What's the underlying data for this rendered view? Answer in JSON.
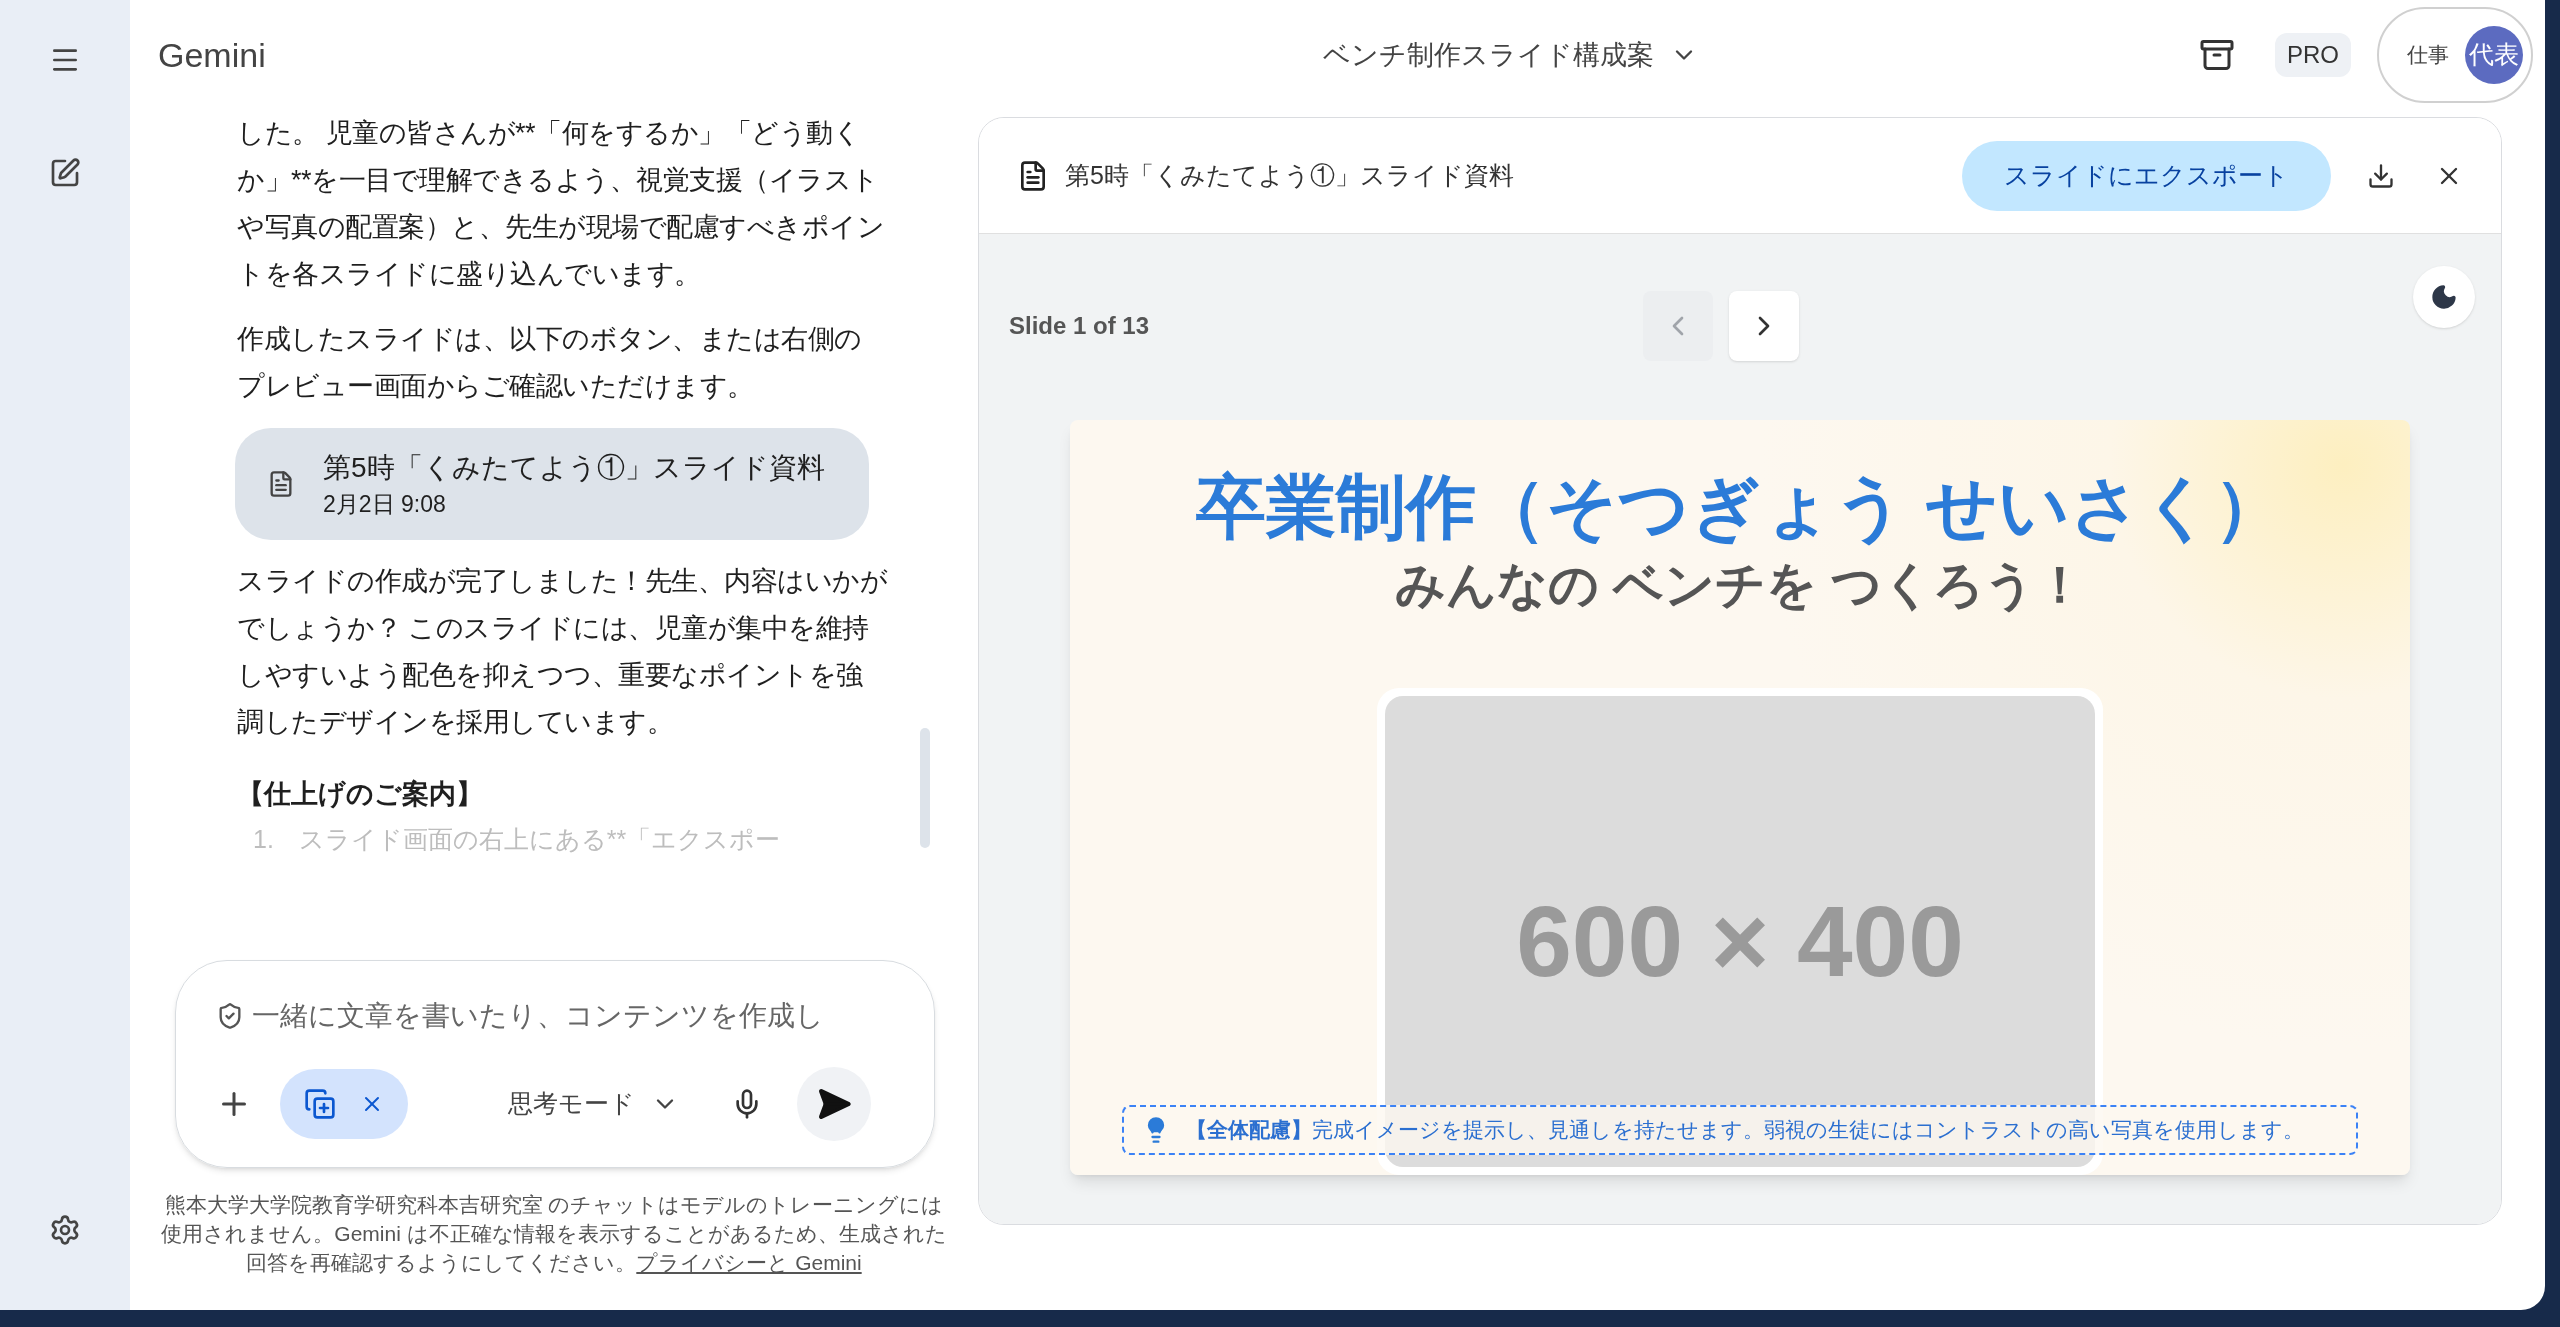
{
  "header": {
    "app_name": "Gemini",
    "conversation_title": "ベンチ制作スライド構成案",
    "plan_badge": "PRO",
    "account_label": "仕事",
    "avatar_text": "代表"
  },
  "chat": {
    "messages": [
      {
        "kind": "paragraph",
        "text": "した。 児童の皆さんが**「何をするか」「どう動くか」**を一目で理解できるよう、視覚支援（イラストや写真の配置案）と、先生が現場で配慮すべきポイントを各スライドに盛り込んでいます。"
      },
      {
        "kind": "paragraph",
        "text": "作成したスライドは、以下のボタン、または右側のプレビュー画面からご確認いただけます。"
      },
      {
        "kind": "file",
        "text": "第5時「くみたてよう①」スライド資料",
        "date": "2月2日 9:08"
      },
      {
        "kind": "paragraph",
        "text": "スライドの作成が完了しました！先生、内容はいかがでしょうか？ このスライドには、児童が集中を維持しやすいよう配色を抑えつつ、重要なポイントを強調したデザインを採用しています。"
      },
      {
        "kind": "heading",
        "text": "【仕上げのご案内】"
      },
      {
        "kind": "faded",
        "text": "1.　スライド画面の右上にある**「エクスポー"
      }
    ],
    "input": {
      "placeholder": "一緒に文章を書いたり、コンテンツを作成し",
      "tool_chip_active": true,
      "mode": "思考モード"
    },
    "footer": {
      "text": "熊本大学大学院教育学研究科本吉研究室 のチャットはモデルのトレーニングには使用されません。Gemini は不正確な情報を表示することがあるため、生成された回答を再確認するようにしてください。",
      "link": "プライバシーと Gemini"
    }
  },
  "panel": {
    "title": "第5時「くみたてよう①」スライド資料",
    "export_button": "スライドにエクスポート",
    "slide_counter": "Slide 1 of 13",
    "prev_disabled": true,
    "next_disabled": false,
    "slide": {
      "title": "卒業制作（そつぎょう せいさく）",
      "subtitle": "みんなの ベンチを つくろう！",
      "image_placeholder": "600 × 400",
      "note": "**【全体配慮】**完成イメージを提示し、見通しを持たせます。弱視の生徒にはコントラストの高い写真を使用します。"
    }
  }
}
